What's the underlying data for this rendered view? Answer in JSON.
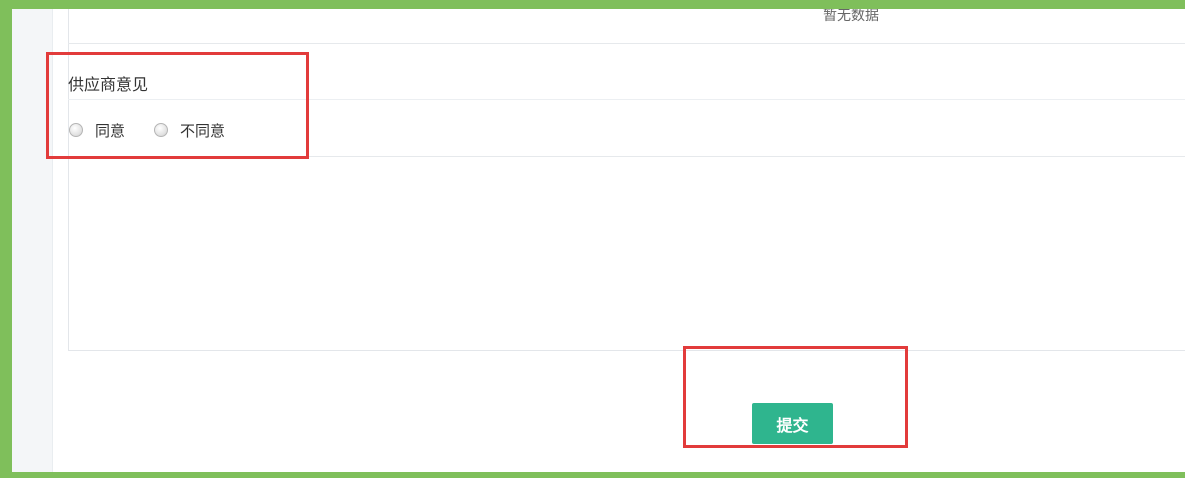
{
  "table": {
    "no_data_text": "暂无数据"
  },
  "supplier_opinion": {
    "title": "供应商意见",
    "options": [
      {
        "label": "同意",
        "selected": false
      },
      {
        "label": "不同意",
        "selected": false
      }
    ]
  },
  "actions": {
    "submit_label": "提交"
  },
  "colors": {
    "frame_border": "#7fbf5b",
    "submit_button": "#2fb58e",
    "annotation_box": "#e23b3b"
  }
}
